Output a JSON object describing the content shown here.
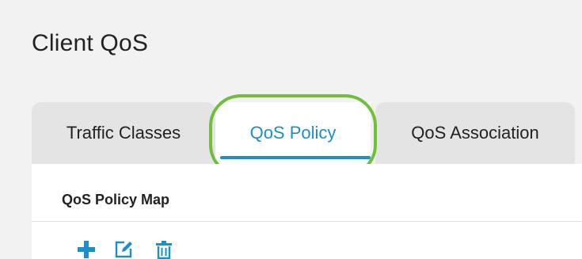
{
  "page": {
    "title": "Client QoS"
  },
  "tabs": [
    {
      "label": "Traffic Classes",
      "active": false
    },
    {
      "label": "QoS Policy",
      "active": true
    },
    {
      "label": "QoS Association",
      "active": false
    }
  ],
  "panel": {
    "title": "QoS Policy Map"
  },
  "toolbar": {
    "buttons": [
      {
        "name": "add",
        "icon": "plus-icon"
      },
      {
        "name": "edit",
        "icon": "edit-icon"
      },
      {
        "name": "delete",
        "icon": "trash-icon"
      }
    ]
  },
  "colors": {
    "accent": "#1a8fc9",
    "highlight": "#6fbf3a"
  }
}
